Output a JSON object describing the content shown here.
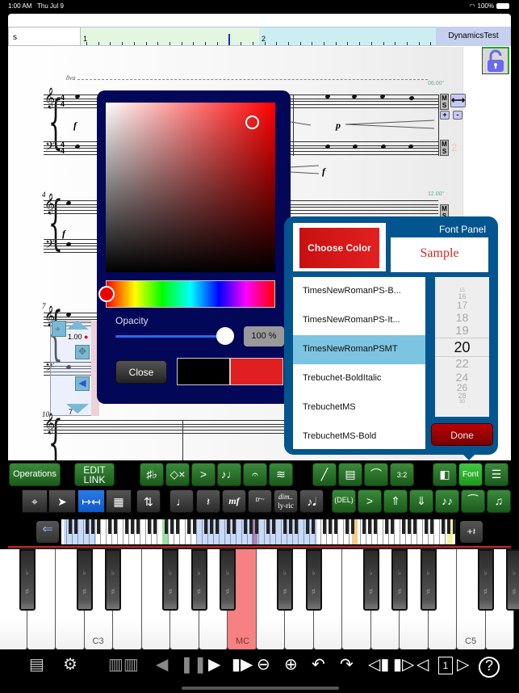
{
  "status_bar": {
    "time": "1:00 AM",
    "date": "Thu Jul 9",
    "battery": "100%"
  },
  "header": {
    "score_name_field": "s",
    "ruler": {
      "measure_labels": [
        "1",
        "2"
      ]
    },
    "document_title": "DynamicsTest"
  },
  "score": {
    "octave_mark": "8va",
    "timings": [
      "06.00\"",
      "12.00\""
    ],
    "measure_numbers": [
      "4",
      "7",
      "10"
    ],
    "staff_side_number": "2",
    "dynamics": {
      "f": "f",
      "p": "p"
    },
    "mute_solo": {
      "m": "M",
      "s": "S"
    },
    "plus": "+",
    "minus": "-",
    "selection_value": "1.00",
    "selection_count": "7"
  },
  "color_picker": {
    "selected_hue": "red",
    "opacity_label": "Opacity",
    "opacity_value": "100 %",
    "opacity_fraction": 1.0,
    "close_label": "Close",
    "old_color": "#000000",
    "new_color": "#e02020"
  },
  "font_panel": {
    "title": "Font Panel",
    "choose_color_label": "Choose Color",
    "sample_label": "Sample",
    "fonts": [
      {
        "name": "TimesNewRomanPS-B...",
        "selected": false
      },
      {
        "name": "TimesNewRomanPS-It...",
        "selected": false
      },
      {
        "name": "TimesNewRomanPSMT",
        "selected": true
      },
      {
        "name": "Trebuchet-BoldItalic",
        "selected": false
      },
      {
        "name": "TrebuchetMS",
        "selected": false
      },
      {
        "name": "TrebuchetMS-Bold",
        "selected": false
      }
    ],
    "sizes": [
      "15",
      "16",
      "17",
      "18",
      "19",
      "20",
      "22",
      "24",
      "26",
      "28",
      "30"
    ],
    "selected_size": "20",
    "done_label": "Done"
  },
  "toolbar": {
    "operations_label": "Operations",
    "edit_link_label": "EDIT\nLINK",
    "font_label": "Font",
    "del_label": "DEL",
    "dim_label": "dim..",
    "lyric_label": "ly-ric",
    "mf_label": "mf",
    "tr_label": "tr~",
    "tuplet_label": "3:2"
  },
  "keyboard": {
    "labels": {
      "c3": "C3",
      "mc": "MC",
      "c5": "C5"
    },
    "flat": "♭",
    "sharp": "♯"
  },
  "bottom_bar": {
    "page_number": "1",
    "help": "?"
  }
}
